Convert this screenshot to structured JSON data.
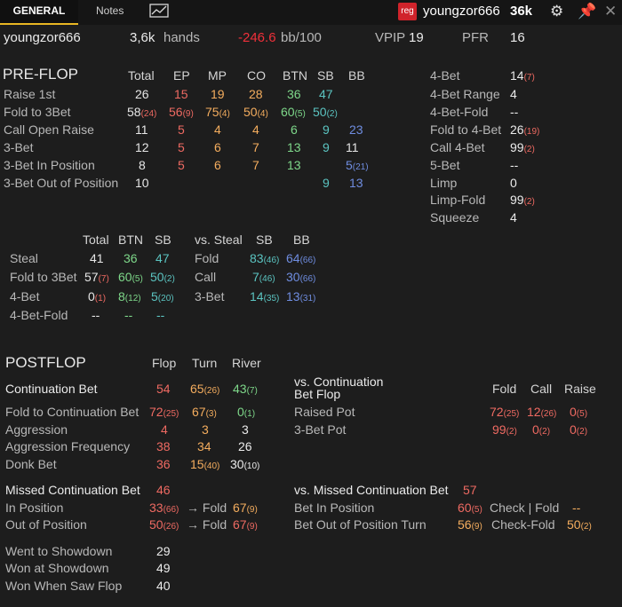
{
  "tabs": {
    "general": "GENERAL",
    "notes": "Notes"
  },
  "top": {
    "badge": "reg",
    "player": "youngzor666",
    "hands": "36k"
  },
  "summary": {
    "player": "youngzor666",
    "hands_value": "3,6k",
    "hands_label": "hands",
    "bb_value": "-246.6",
    "bb_label": "bb/100",
    "vpip_label": "VPIP",
    "vpip": "19",
    "pfr_label": "PFR",
    "pfr": "16"
  },
  "preflop": {
    "title": "PRE-FLOP",
    "columns": [
      "Total",
      "EP",
      "MP",
      "CO",
      "BTN",
      "SB",
      "BB"
    ],
    "rows": [
      {
        "label": "Raise 1st",
        "vals": [
          "26",
          "15",
          "19",
          "28",
          "36",
          "47",
          ""
        ],
        "subs": [
          "",
          "",
          "",
          "",
          "",
          "",
          ""
        ]
      },
      {
        "label": "Fold to 3Bet",
        "vals": [
          "58",
          "56",
          "75",
          "50",
          "60",
          "50",
          ""
        ],
        "subs": [
          "(24)",
          "(9)",
          "(4)",
          "(4)",
          "(5)",
          "(2)",
          ""
        ]
      },
      {
        "label": "Call Open Raise",
        "vals": [
          "11",
          "5",
          "4",
          "4",
          "6",
          "9",
          "23"
        ],
        "subs": [
          "",
          "",
          "",
          "",
          "",
          "",
          ""
        ]
      },
      {
        "label": "3-Bet",
        "vals": [
          "12",
          "5",
          "6",
          "7",
          "13",
          "9",
          "11"
        ],
        "subs": [
          "",
          "",
          "",
          "",
          "",
          "",
          ""
        ]
      },
      {
        "label": "3-Bet In Position",
        "vals": [
          "8",
          "5",
          "6",
          "7",
          "13",
          "",
          "5"
        ],
        "subs": [
          "",
          "",
          "",
          "",
          "",
          "",
          "(21)"
        ]
      },
      {
        "label": "3-Bet Out of Position",
        "vals": [
          "10",
          "",
          "",
          "",
          "",
          "9",
          "13"
        ],
        "subs": [
          "",
          "",
          "",
          "",
          "",
          "",
          ""
        ]
      }
    ]
  },
  "preflop_right": [
    {
      "label": "4-Bet",
      "val": "14",
      "sub": "(7)"
    },
    {
      "label": "4-Bet Range",
      "val": "4",
      "sub": ""
    },
    {
      "label": "4-Bet-Fold",
      "val": "--",
      "sub": ""
    },
    {
      "label": "Fold to 4-Bet",
      "val": "26",
      "sub": "(19)"
    },
    {
      "label": "Call 4-Bet",
      "val": "99",
      "sub": "(2)"
    },
    {
      "label": "5-Bet",
      "val": "--",
      "sub": ""
    },
    {
      "label": "Limp",
      "val": "0",
      "sub": ""
    },
    {
      "label": "Limp-Fold",
      "val": "99",
      "sub": "(2)"
    },
    {
      "label": "Squeeze",
      "val": "4",
      "sub": ""
    }
  ],
  "steal": {
    "columns": [
      "Total",
      "BTN",
      "SB"
    ],
    "rows": [
      {
        "label": "Steal",
        "vals": [
          "41",
          "36",
          "47"
        ],
        "subs": [
          "",
          "",
          ""
        ]
      },
      {
        "label": "Fold to 3Bet",
        "vals": [
          "57",
          "60",
          "50"
        ],
        "subs": [
          "(7)",
          "(5)",
          "(2)"
        ]
      },
      {
        "label": "4-Bet",
        "vals": [
          "0",
          "8",
          "5"
        ],
        "subs": [
          "(1)",
          "(12)",
          "(20)"
        ]
      },
      {
        "label": "4-Bet-Fold",
        "vals": [
          "--",
          "--",
          "--"
        ],
        "subs": [
          "",
          "",
          ""
        ]
      }
    ]
  },
  "vs_steal": {
    "title": "vs. Steal",
    "columns": [
      "SB",
      "BB"
    ],
    "rows": [
      {
        "label": "Fold",
        "vals": [
          "83",
          "64"
        ],
        "subs": [
          "(46)",
          "(66)"
        ]
      },
      {
        "label": "Call",
        "vals": [
          "7",
          "30"
        ],
        "subs": [
          "(46)",
          "(66)"
        ]
      },
      {
        "label": "3-Bet",
        "vals": [
          "14",
          "13"
        ],
        "subs": [
          "(35)",
          "(31)"
        ]
      }
    ]
  },
  "postflop": {
    "title": "POSTFLOP",
    "columns": [
      "Flop",
      "Turn",
      "River"
    ],
    "rows": [
      {
        "label": "Continuation Bet",
        "vals": [
          "54",
          "65",
          "43"
        ],
        "subs": [
          "",
          "(26)",
          "(7)"
        ]
      },
      {
        "label": "Fold to Continuation Bet",
        "vals": [
          "72",
          "67",
          "0"
        ],
        "subs": [
          "(25)",
          "(3)",
          "(1)"
        ]
      },
      {
        "label": "Aggression",
        "vals": [
          "4",
          "3",
          "3"
        ],
        "subs": [
          "",
          "",
          ""
        ]
      },
      {
        "label": "Aggression Frequency",
        "vals": [
          "38",
          "34",
          "26"
        ],
        "subs": [
          "",
          "",
          ""
        ]
      },
      {
        "label": "Donk Bet",
        "vals": [
          "36",
          "15",
          "30"
        ],
        "subs": [
          "",
          "(40)",
          "(10)"
        ]
      }
    ]
  },
  "vs_cbet": {
    "title_line1": "vs. Continuation",
    "title_line2": "Bet Flop",
    "columns": [
      "Fold",
      "Call",
      "Raise"
    ],
    "rows": [
      {
        "label": "Raised Pot",
        "vals": [
          "72",
          "12",
          "0"
        ],
        "subs": [
          "(25)",
          "(26)",
          "(5)"
        ]
      },
      {
        "label": "3-Bet Pot",
        "vals": [
          "99",
          "0",
          "0"
        ],
        "subs": [
          "(2)",
          "(2)",
          "(2)"
        ]
      }
    ]
  },
  "missed_cbet": {
    "title": "Missed Continuation Bet",
    "value": "46",
    "arrow": "→ Fold",
    "rows": [
      {
        "label": "In Position",
        "val": "33",
        "sub": "(66)",
        "fold": "67",
        "fold_sub": "(9)"
      },
      {
        "label": "Out of Position",
        "val": "50",
        "sub": "(26)",
        "fold": "67",
        "fold_sub": "(9)"
      }
    ]
  },
  "vs_missed_cbet": {
    "title": "vs. Missed Continuation Bet",
    "value": "57",
    "rows": [
      {
        "label": "Bet In Position",
        "val": "60",
        "sub": "(5)",
        "label2": "Check | Fold",
        "val2": "--",
        "sub2": ""
      },
      {
        "label": "Bet Out of Position Turn",
        "val": "56",
        "sub": "(9)",
        "label2": "Check-Fold",
        "val2": "50",
        "sub2": "(2)"
      }
    ]
  },
  "showdown": [
    {
      "label": "Went to Showdown",
      "val": "29"
    },
    {
      "label": "Won at Showdown",
      "val": "49"
    },
    {
      "label": "Won When Saw Flop",
      "val": "40"
    }
  ]
}
